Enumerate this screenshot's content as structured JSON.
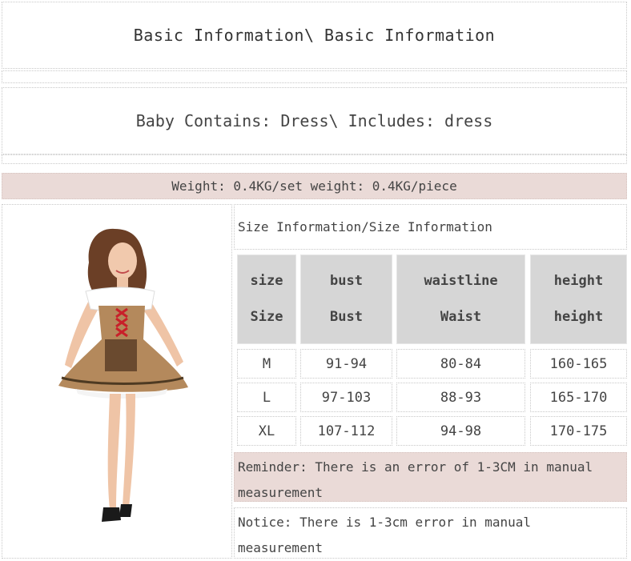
{
  "header": {
    "basic_info": "Basic Information\\ Basic Information",
    "contains": "Baby Contains: Dress\\ Includes: dress",
    "weight": "Weight: 0.4KG/set weight: 0.4KG/piece"
  },
  "size_table": {
    "title": "Size Information/Size Information",
    "headers": [
      {
        "top": "size",
        "bottom": "Size"
      },
      {
        "top": "bust",
        "bottom": "Bust"
      },
      {
        "top": "waistline",
        "bottom": "Waist"
      },
      {
        "top": "height",
        "bottom": "height"
      }
    ],
    "rows": [
      [
        "M",
        "91-94",
        "80-84",
        "160-165"
      ],
      [
        "L",
        "97-103",
        "88-93",
        "165-170"
      ],
      [
        "XL",
        "107-112",
        "94-98",
        "170-175"
      ]
    ]
  },
  "notes": {
    "reminder": "Reminder: There is an error of 1-3CM in manual measurement",
    "notice": "Notice: There is 1-3cm error in manual measurement"
  },
  "colors": {
    "accent_band": "#eadad7",
    "header_cell": "#d6d6d6",
    "dress_brown": "#b4895c",
    "lace_red": "#c8202a"
  },
  "image": {
    "subject": "woman-in-brown-dirndl-dress"
  }
}
